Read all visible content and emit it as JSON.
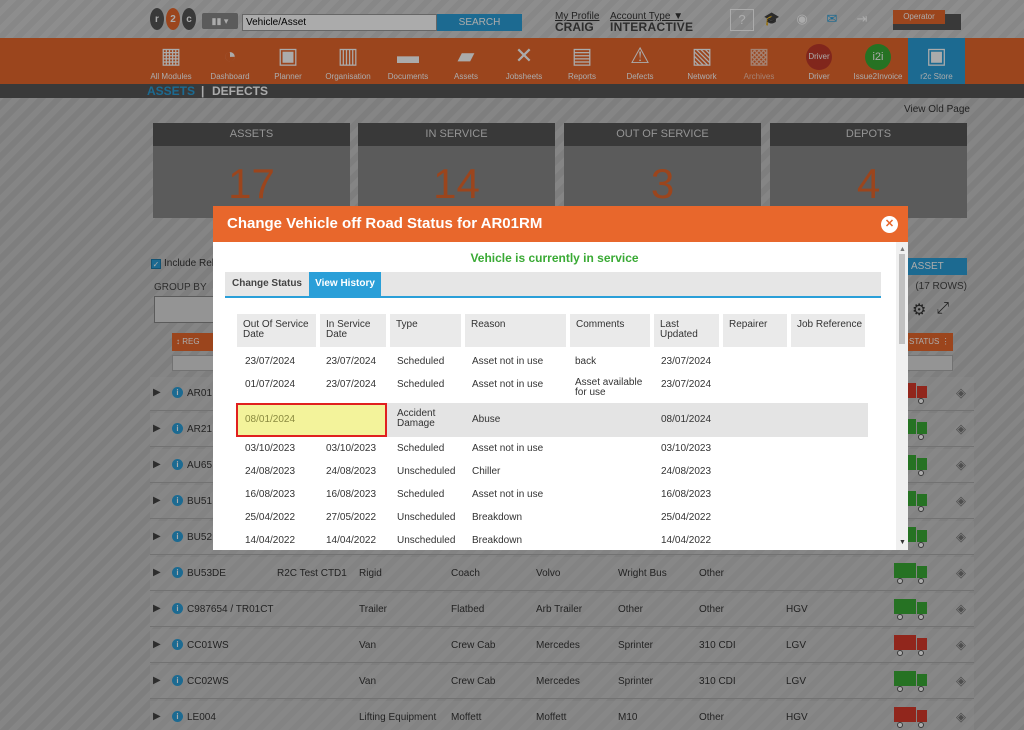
{
  "header": {
    "logo_text": [
      "r",
      "2",
      "c"
    ],
    "search_placeholder": "Vehicle/Asset",
    "search_button": "SEARCH",
    "profile_link": "My Profile",
    "profile_name": "CRAIG",
    "account_link": "Account Type ▼",
    "account_name": "INTERACTIVE",
    "operator_label": "Operator"
  },
  "nav": {
    "items": [
      {
        "label": "All Modules",
        "icon": "grid-icon"
      },
      {
        "label": "Dashboard",
        "icon": "gauge-icon"
      },
      {
        "label": "Planner",
        "icon": "calendar-icon",
        "day": "12"
      },
      {
        "label": "Organisation",
        "icon": "building-icon"
      },
      {
        "label": "Documents",
        "icon": "folder-icon"
      },
      {
        "label": "Assets",
        "icon": "truck-icon"
      },
      {
        "label": "Jobsheets",
        "icon": "tools-icon"
      },
      {
        "label": "Reports",
        "icon": "clipboard-icon"
      },
      {
        "label": "Defects",
        "icon": "warning-icon"
      },
      {
        "label": "Network",
        "icon": "contact-icon"
      },
      {
        "label": "Archives",
        "icon": "archive-icon"
      },
      {
        "label": "Driver",
        "icon": "driver-icon"
      },
      {
        "label": "Issue2Invoice",
        "icon": "i2i-icon"
      },
      {
        "label": "r2c Store",
        "icon": "briefcase-icon"
      }
    ],
    "driver_badge": "Driver",
    "i2i_badge": "i2i"
  },
  "subnav": {
    "assets": "ASSETS",
    "sep": "|",
    "defects": "DEFECTS"
  },
  "view_old_page": "View Old Page",
  "stats": [
    {
      "label": "ASSETS",
      "value": "17"
    },
    {
      "label": "IN SERVICE",
      "value": "14"
    },
    {
      "label": "OUT OF SERVICE",
      "value": "3"
    },
    {
      "label": "DEPOTS",
      "value": "4"
    }
  ],
  "include_label": "Include Rela",
  "group_by": "GROUP BY",
  "left_col_header": "REG",
  "asset_button": "ASSET",
  "rows_count": "(17 ROWS)",
  "status_header": "STATUS",
  "bg_rows": [
    {
      "reg": "AR01",
      "status": "red"
    },
    {
      "reg": "AR21",
      "status": "green"
    },
    {
      "reg": "AU65",
      "status": "green"
    },
    {
      "reg": "BU51",
      "status": "green"
    },
    {
      "reg": "BU52",
      "status": "green"
    },
    {
      "reg": "BU53DE",
      "depot": "R2C Test CTD1",
      "kind": "Rigid",
      "body": "Coach",
      "make": "Volvo",
      "model": "Wright Bus",
      "variant": "Other",
      "cls": "",
      "status": "green"
    },
    {
      "reg": "C987654 / TR01CT",
      "depot": "",
      "kind": "Trailer",
      "body": "Flatbed",
      "make": "Arb Trailer",
      "model": "Other",
      "variant": "Other",
      "cls": "HGV",
      "status": "green"
    },
    {
      "reg": "CC01WS",
      "depot": "",
      "kind": "Van",
      "body": "Crew Cab",
      "make": "Mercedes",
      "model": "Sprinter",
      "variant": "310 CDI",
      "cls": "LGV",
      "status": "red"
    },
    {
      "reg": "CC02WS",
      "depot": "",
      "kind": "Van",
      "body": "Crew Cab",
      "make": "Mercedes",
      "model": "Sprinter",
      "variant": "310 CDI",
      "cls": "LGV",
      "status": "green"
    },
    {
      "reg": "LE004",
      "depot": "",
      "kind": "Lifting Equipment",
      "body": "Moffett",
      "make": "Moffett",
      "model": "M10",
      "variant": "Other",
      "cls": "HGV",
      "status": "red"
    }
  ],
  "modal": {
    "title": "Change Vehicle off Road Status for AR01RM",
    "status_message": "Vehicle is currently in service",
    "tabs": [
      "Change Status",
      "View History"
    ],
    "active_tab": "View History",
    "columns": [
      "Out Of Service Date",
      "In Service Date",
      "Type",
      "Reason",
      "Comments",
      "Last Updated",
      "Repairer",
      "Job Reference"
    ],
    "rows": [
      {
        "out": "23/07/2024",
        "in": "23/07/2024",
        "type": "Scheduled",
        "reason": "Asset not in use",
        "comments": "back",
        "updated": "23/07/2024",
        "repairer": "",
        "job": ""
      },
      {
        "out": "01/07/2024",
        "in": "23/07/2024",
        "type": "Scheduled",
        "reason": "Asset not in use",
        "comments": "Asset available for use",
        "updated": "23/07/2024",
        "repairer": "",
        "job": ""
      },
      {
        "out": "08/01/2024",
        "in": "",
        "type": "Accident Damage",
        "reason": "Abuse",
        "comments": "",
        "updated": "08/01/2024",
        "repairer": "",
        "job": ""
      },
      {
        "out": "03/10/2023",
        "in": "03/10/2023",
        "type": "Scheduled",
        "reason": "Asset not in use",
        "comments": "",
        "updated": "03/10/2023",
        "repairer": "",
        "job": ""
      },
      {
        "out": "24/08/2023",
        "in": "24/08/2023",
        "type": "Unscheduled",
        "reason": "Chiller",
        "comments": "",
        "updated": "24/08/2023",
        "repairer": "",
        "job": ""
      },
      {
        "out": "16/08/2023",
        "in": "16/08/2023",
        "type": "Scheduled",
        "reason": "Asset not in use",
        "comments": "",
        "updated": "16/08/2023",
        "repairer": "",
        "job": ""
      },
      {
        "out": "25/04/2022",
        "in": "27/05/2022",
        "type": "Unscheduled",
        "reason": "Breakdown",
        "comments": "",
        "updated": "25/04/2022",
        "repairer": "",
        "job": ""
      },
      {
        "out": "14/04/2022",
        "in": "14/04/2022",
        "type": "Unscheduled",
        "reason": "Breakdown",
        "comments": "",
        "updated": "14/04/2022",
        "repairer": "",
        "job": ""
      }
    ]
  },
  "colors": {
    "accent": "#e8672c",
    "blue": "#2a9fd8",
    "green": "#3aaa35",
    "red": "#d93a2b"
  }
}
